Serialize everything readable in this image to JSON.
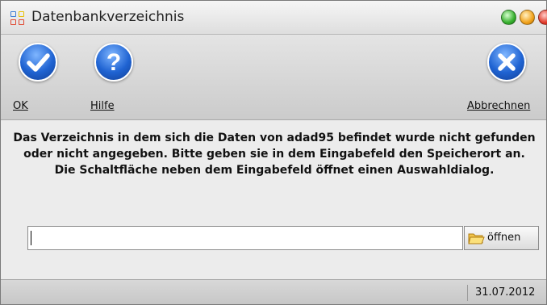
{
  "window": {
    "title": "Datenbankverzeichnis"
  },
  "toolbar": {
    "ok_label": "OK",
    "help_label": "Hilfe",
    "cancel_label": "Abbrechnen"
  },
  "message": "Das Verzeichnis in dem sich die Daten von adad95 befindet wurde nicht gefunden oder nicht angegeben.  Bitte geben sie in dem Eingabefeld den Speicherort an.  Die Schaltfläche neben dem Eingabefeld öffnet einen Auswahldialog.",
  "path_input": {
    "value": "",
    "placeholder": ""
  },
  "open_button": {
    "label": "öffnen",
    "icon": "folder-open-icon"
  },
  "status": {
    "date": "31.07.2012"
  },
  "colors": {
    "accent": "#1f63d2",
    "window_bg": "#ececec"
  }
}
